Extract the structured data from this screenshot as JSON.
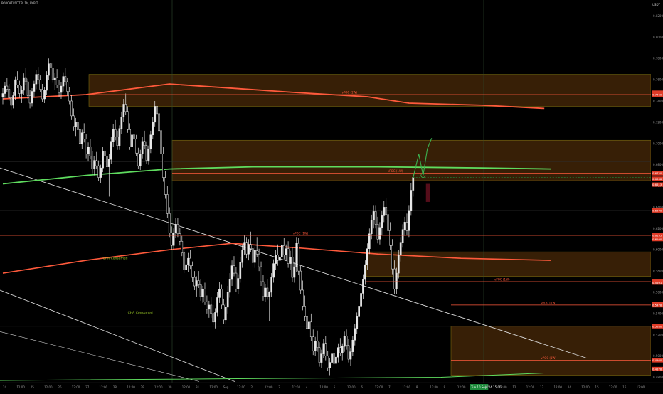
{
  "header": {
    "symbol_line": "POPCATUSDT.P, 1h, BYBIT",
    "currency": "USDT"
  },
  "colors": {
    "background": "#000000",
    "candle": "#e8e8e8",
    "zone_fill": "#4a2a08",
    "zone_border": "#7a6a10",
    "poc_line": "#ff5a3c",
    "vwap_green": "#5fdc5f",
    "trendline": "#d8d8d8",
    "price_badge": "#1e8c3c",
    "label_red": "#e03c28",
    "annotation_green": "#a0d028",
    "forecast_green": "#3cb450"
  },
  "chart_data": {
    "type": "candlestick",
    "title": "POPCATUSDT.P, 1h, BYBIT",
    "y_axis": {
      "ticks": [
        "0.8200",
        "0.8000",
        "0.7800",
        "0.7600",
        "0.7400",
        "0.7200",
        "0.7000",
        "0.6800",
        "0.6600",
        "0.6400",
        "0.6200",
        "0.6000",
        "0.5800",
        "0.5600",
        "0.5400",
        "0.5200",
        "0.5000",
        "0.4800"
      ],
      "ylim": [
        0.475,
        0.835
      ]
    },
    "x_axis": {
      "ticks": [
        "24",
        "12:00",
        "25",
        "12:00",
        "26",
        "12:00",
        "27",
        "12:00",
        "28",
        "12:00",
        "29",
        "12:00",
        "30",
        "12:00",
        "31",
        "12:00",
        "Sep",
        "12:00",
        "2",
        "12:00",
        "3",
        "12:00",
        "4",
        "12:00",
        "5",
        "12:00",
        "6",
        "12:00",
        "7",
        "12:00",
        "8",
        "12:00",
        "9",
        "12:00",
        "Tue 10 Sep '24  15:00",
        "11",
        "12:00",
        "12",
        "12:00",
        "13",
        "12:00",
        "14",
        "12:00",
        "15",
        "12:00",
        "16",
        "12:00"
      ]
    },
    "last_price": "0.6679",
    "price_labels": [
      "0.7478",
      "0.7460",
      "0.6720",
      "0.6668",
      "0.6613",
      "0.6370",
      "0.6135",
      "0.6100",
      "0.5700",
      "0.5691",
      "0.5489",
      "0.5478",
      "0.5280",
      "0.4960",
      "0.4878"
    ],
    "zones": [
      {
        "top": 0.765,
        "bottom": 0.735
      },
      {
        "top": 0.703,
        "bottom": 0.665
      },
      {
        "top": 0.598,
        "bottom": 0.575
      },
      {
        "top": 0.528,
        "bottom": 0.482
      }
    ],
    "levels": [
      {
        "label": "vPOC (1W)",
        "value": 0.746
      },
      {
        "label": "vPOC (1W)",
        "value": 0.672
      },
      {
        "label": "vPOC (1W)",
        "value": 0.6135
      },
      {
        "label": "vPOC (1W)",
        "value": 0.57
      },
      {
        "label": "vPOC (1W)",
        "value": 0.548
      },
      {
        "label": "vPOC (1W)",
        "value": 0.496
      }
    ],
    "annotations": [
      {
        "text": "CHA Consumed",
        "x_index": 48,
        "value": 0.591
      },
      {
        "text": "CHA Consumed",
        "x_index": 60,
        "value": 0.54
      }
    ],
    "vwap_curves": [
      {
        "name": "",
        "values_at": [
          [
            0,
            0.742
          ],
          [
            40,
            0.746
          ],
          [
            80,
            0.756
          ],
          [
            140,
            0.748
          ],
          [
            175,
            0.744
          ],
          [
            195,
            0.738
          ],
          [
            230,
            0.736
          ],
          [
            260,
            0.733
          ]
        ]
      },
      {
        "name": "",
        "values_at": [
          [
            0,
            0.578
          ],
          [
            40,
            0.59
          ],
          [
            80,
            0.6
          ],
          [
            110,
            0.606
          ],
          [
            140,
            0.602
          ],
          [
            180,
            0.596
          ],
          [
            220,
            0.592
          ],
          [
            263,
            0.59
          ]
        ]
      },
      {
        "name": "",
        "values_at": [
          [
            0,
            0.662
          ],
          [
            40,
            0.67
          ],
          [
            80,
            0.676
          ],
          [
            120,
            0.678
          ],
          [
            180,
            0.678
          ],
          [
            230,
            0.677
          ],
          [
            263,
            0.676
          ]
        ]
      }
    ],
    "candles": [
      [
        0.744,
        0.752,
        0.737,
        0.747
      ],
      [
        0.747,
        0.758,
        0.743,
        0.754
      ],
      [
        0.754,
        0.762,
        0.748,
        0.751
      ],
      [
        0.751,
        0.756,
        0.74,
        0.743
      ],
      [
        0.743,
        0.749,
        0.732,
        0.736
      ],
      [
        0.736,
        0.748,
        0.733,
        0.745
      ],
      [
        0.745,
        0.763,
        0.741,
        0.76
      ],
      [
        0.76,
        0.768,
        0.752,
        0.755
      ],
      [
        0.755,
        0.759,
        0.743,
        0.747
      ],
      [
        0.747,
        0.754,
        0.738,
        0.75
      ],
      [
        0.75,
        0.766,
        0.746,
        0.762
      ],
      [
        0.762,
        0.771,
        0.755,
        0.758
      ],
      [
        0.758,
        0.761,
        0.742,
        0.745
      ],
      [
        0.745,
        0.75,
        0.733,
        0.738
      ],
      [
        0.738,
        0.752,
        0.735,
        0.749
      ],
      [
        0.749,
        0.759,
        0.744,
        0.756
      ],
      [
        0.756,
        0.769,
        0.751,
        0.765
      ],
      [
        0.765,
        0.772,
        0.756,
        0.76
      ],
      [
        0.76,
        0.764,
        0.748,
        0.751
      ],
      [
        0.751,
        0.756,
        0.739,
        0.742
      ],
      [
        0.742,
        0.753,
        0.738,
        0.75
      ],
      [
        0.75,
        0.768,
        0.746,
        0.764
      ],
      [
        0.764,
        0.78,
        0.76,
        0.775
      ],
      [
        0.775,
        0.788,
        0.768,
        0.771
      ],
      [
        0.771,
        0.776,
        0.757,
        0.76
      ],
      [
        0.76,
        0.766,
        0.75,
        0.762
      ],
      [
        0.762,
        0.77,
        0.752,
        0.755
      ],
      [
        0.755,
        0.76,
        0.744,
        0.748
      ],
      [
        0.748,
        0.758,
        0.742,
        0.754
      ],
      [
        0.754,
        0.767,
        0.749,
        0.763
      ],
      [
        0.763,
        0.771,
        0.755,
        0.758
      ],
      [
        0.758,
        0.762,
        0.745,
        0.749
      ],
      [
        0.749,
        0.753,
        0.737,
        0.74
      ],
      [
        0.74,
        0.746,
        0.722,
        0.726
      ],
      [
        0.726,
        0.733,
        0.712,
        0.716
      ],
      [
        0.716,
        0.724,
        0.707,
        0.72
      ],
      [
        0.72,
        0.728,
        0.71,
        0.713
      ],
      [
        0.713,
        0.718,
        0.697,
        0.7
      ],
      [
        0.7,
        0.713,
        0.695,
        0.71
      ],
      [
        0.71,
        0.719,
        0.701,
        0.704
      ],
      [
        0.704,
        0.709,
        0.686,
        0.69
      ],
      [
        0.69,
        0.701,
        0.683,
        0.697
      ],
      [
        0.697,
        0.704,
        0.685,
        0.688
      ],
      [
        0.688,
        0.693,
        0.672,
        0.676
      ],
      [
        0.676,
        0.688,
        0.67,
        0.684
      ],
      [
        0.684,
        0.692,
        0.676,
        0.679
      ],
      [
        0.679,
        0.684,
        0.665,
        0.668
      ],
      [
        0.668,
        0.68,
        0.663,
        0.677
      ],
      [
        0.677,
        0.697,
        0.673,
        0.693
      ],
      [
        0.693,
        0.704,
        0.685,
        0.688
      ],
      [
        0.688,
        0.693,
        0.674,
        0.678
      ],
      [
        0.678,
        0.69,
        0.65,
        0.685
      ],
      [
        0.685,
        0.706,
        0.681,
        0.702
      ],
      [
        0.702,
        0.718,
        0.697,
        0.713
      ],
      [
        0.713,
        0.722,
        0.703,
        0.706
      ],
      [
        0.706,
        0.712,
        0.694,
        0.698
      ],
      [
        0.698,
        0.717,
        0.694,
        0.714
      ],
      [
        0.714,
        0.73,
        0.709,
        0.725
      ],
      [
        0.725,
        0.742,
        0.72,
        0.737
      ],
      [
        0.737,
        0.747,
        0.727,
        0.73
      ],
      [
        0.73,
        0.735,
        0.71,
        0.713
      ],
      [
        0.713,
        0.719,
        0.694,
        0.697
      ],
      [
        0.697,
        0.712,
        0.692,
        0.708
      ],
      [
        0.708,
        0.72,
        0.701,
        0.704
      ],
      [
        0.704,
        0.708,
        0.688,
        0.691
      ],
      [
        0.691,
        0.696,
        0.676,
        0.679
      ],
      [
        0.679,
        0.694,
        0.675,
        0.69
      ],
      [
        0.69,
        0.706,
        0.686,
        0.702
      ],
      [
        0.702,
        0.712,
        0.695,
        0.698
      ],
      [
        0.698,
        0.702,
        0.681,
        0.684
      ],
      [
        0.684,
        0.698,
        0.68,
        0.695
      ],
      [
        0.695,
        0.712,
        0.691,
        0.708
      ],
      [
        0.708,
        0.725,
        0.704,
        0.72
      ],
      [
        0.72,
        0.74,
        0.716,
        0.735
      ],
      [
        0.735,
        0.745,
        0.724,
        0.728
      ],
      [
        0.728,
        0.734,
        0.708,
        0.712
      ],
      [
        0.712,
        0.718,
        0.686,
        0.69
      ],
      [
        0.69,
        0.697,
        0.664,
        0.668
      ],
      [
        0.668,
        0.674,
        0.648,
        0.652
      ],
      [
        0.652,
        0.66,
        0.63,
        0.634
      ],
      [
        0.634,
        0.64,
        0.612,
        0.616
      ],
      [
        0.616,
        0.622,
        0.6,
        0.604
      ],
      [
        0.604,
        0.62,
        0.6,
        0.616
      ],
      [
        0.616,
        0.63,
        0.611,
        0.624
      ],
      [
        0.624,
        0.63,
        0.612,
        0.615
      ],
      [
        0.615,
        0.621,
        0.604,
        0.608
      ],
      [
        0.608,
        0.613,
        0.594,
        0.597
      ],
      [
        0.597,
        0.602,
        0.578,
        0.581
      ],
      [
        0.581,
        0.59,
        0.57,
        0.586
      ],
      [
        0.586,
        0.597,
        0.579,
        0.592
      ],
      [
        0.592,
        0.6,
        0.582,
        0.585
      ],
      [
        0.585,
        0.589,
        0.57,
        0.574
      ],
      [
        0.574,
        0.58,
        0.562,
        0.566
      ],
      [
        0.566,
        0.575,
        0.556,
        0.571
      ],
      [
        0.571,
        0.58,
        0.564,
        0.567
      ],
      [
        0.567,
        0.572,
        0.552,
        0.556
      ],
      [
        0.556,
        0.566,
        0.55,
        0.563
      ],
      [
        0.563,
        0.569,
        0.548,
        0.551
      ],
      [
        0.551,
        0.557,
        0.54,
        0.544
      ],
      [
        0.544,
        0.552,
        0.536,
        0.548
      ],
      [
        0.548,
        0.556,
        0.536,
        0.54
      ],
      [
        0.54,
        0.548,
        0.529,
        0.532
      ],
      [
        0.532,
        0.545,
        0.526,
        0.541
      ],
      [
        0.541,
        0.56,
        0.537,
        0.555
      ],
      [
        0.555,
        0.57,
        0.55,
        0.563
      ],
      [
        0.563,
        0.567,
        0.544,
        0.548
      ],
      [
        0.548,
        0.554,
        0.53,
        0.534
      ],
      [
        0.534,
        0.55,
        0.53,
        0.546
      ],
      [
        0.546,
        0.566,
        0.54,
        0.56
      ],
      [
        0.56,
        0.578,
        0.555,
        0.572
      ],
      [
        0.572,
        0.59,
        0.566,
        0.585
      ],
      [
        0.585,
        0.594,
        0.575,
        0.578
      ],
      [
        0.578,
        0.584,
        0.56,
        0.563
      ],
      [
        0.563,
        0.577,
        0.558,
        0.573
      ],
      [
        0.573,
        0.593,
        0.569,
        0.588
      ],
      [
        0.588,
        0.605,
        0.583,
        0.6
      ],
      [
        0.6,
        0.614,
        0.595,
        0.607
      ],
      [
        0.607,
        0.612,
        0.592,
        0.596
      ],
      [
        0.596,
        0.61,
        0.59,
        0.605
      ],
      [
        0.605,
        0.617,
        0.598,
        0.601
      ],
      [
        0.601,
        0.606,
        0.584,
        0.588
      ],
      [
        0.588,
        0.603,
        0.583,
        0.599
      ],
      [
        0.599,
        0.612,
        0.593,
        0.596
      ],
      [
        0.596,
        0.601,
        0.58,
        0.584
      ],
      [
        0.584,
        0.589,
        0.566,
        0.57
      ],
      [
        0.57,
        0.576,
        0.552,
        0.556
      ],
      [
        0.556,
        0.568,
        0.551,
        0.564
      ],
      [
        0.564,
        0.572,
        0.553,
        0.556
      ],
      [
        0.556,
        0.561,
        0.533,
        0.56
      ],
      [
        0.56,
        0.578,
        0.556,
        0.574
      ],
      [
        0.574,
        0.591,
        0.569,
        0.587
      ],
      [
        0.587,
        0.6,
        0.581,
        0.595
      ],
      [
        0.595,
        0.605,
        0.585,
        0.59
      ],
      [
        0.59,
        0.597,
        0.578,
        0.593
      ],
      [
        0.593,
        0.609,
        0.588,
        0.604
      ],
      [
        0.604,
        0.611,
        0.591,
        0.595
      ],
      [
        0.595,
        0.605,
        0.59,
        0.601
      ],
      [
        0.601,
        0.608,
        0.583,
        0.587
      ],
      [
        0.587,
        0.599,
        0.581,
        0.593
      ],
      [
        0.593,
        0.602,
        0.57,
        0.574
      ],
      [
        0.574,
        0.588,
        0.569,
        0.584
      ],
      [
        0.584,
        0.612,
        0.579,
        0.606
      ],
      [
        0.606,
        0.611,
        0.576,
        0.58
      ],
      [
        0.58,
        0.585,
        0.558,
        0.562
      ],
      [
        0.562,
        0.571,
        0.543,
        0.547
      ],
      [
        0.547,
        0.557,
        0.533,
        0.537
      ],
      [
        0.537,
        0.548,
        0.522,
        0.526
      ],
      [
        0.526,
        0.538,
        0.511,
        0.532
      ],
      [
        0.532,
        0.54,
        0.514,
        0.518
      ],
      [
        0.518,
        0.525,
        0.501,
        0.505
      ],
      [
        0.505,
        0.518,
        0.5,
        0.514
      ],
      [
        0.514,
        0.524,
        0.504,
        0.508
      ],
      [
        0.508,
        0.513,
        0.49,
        0.494
      ],
      [
        0.494,
        0.506,
        0.489,
        0.502
      ],
      [
        0.502,
        0.516,
        0.498,
        0.512
      ],
      [
        0.512,
        0.519,
        0.496,
        0.5
      ],
      [
        0.5,
        0.505,
        0.486,
        0.489
      ],
      [
        0.489,
        0.498,
        0.482,
        0.494
      ],
      [
        0.494,
        0.506,
        0.489,
        0.502
      ],
      [
        0.502,
        0.509,
        0.49,
        0.493
      ],
      [
        0.493,
        0.503,
        0.487,
        0.499
      ],
      [
        0.499,
        0.512,
        0.494,
        0.508
      ],
      [
        0.508,
        0.517,
        0.5,
        0.503
      ],
      [
        0.503,
        0.512,
        0.496,
        0.509
      ],
      [
        0.509,
        0.523,
        0.504,
        0.519
      ],
      [
        0.519,
        0.525,
        0.506,
        0.51
      ],
      [
        0.51,
        0.516,
        0.494,
        0.497
      ],
      [
        0.497,
        0.507,
        0.491,
        0.504
      ],
      [
        0.504,
        0.519,
        0.5,
        0.515
      ],
      [
        0.515,
        0.53,
        0.51,
        0.526
      ],
      [
        0.526,
        0.541,
        0.521,
        0.537
      ],
      [
        0.537,
        0.552,
        0.531,
        0.547
      ],
      [
        0.547,
        0.564,
        0.542,
        0.559
      ],
      [
        0.559,
        0.577,
        0.554,
        0.572
      ],
      [
        0.572,
        0.59,
        0.567,
        0.586
      ],
      [
        0.586,
        0.606,
        0.581,
        0.601
      ],
      [
        0.601,
        0.62,
        0.596,
        0.615
      ],
      [
        0.615,
        0.633,
        0.61,
        0.628
      ],
      [
        0.628,
        0.642,
        0.62,
        0.636
      ],
      [
        0.636,
        0.642,
        0.62,
        0.624
      ],
      [
        0.624,
        0.631,
        0.606,
        0.61
      ],
      [
        0.61,
        0.626,
        0.605,
        0.621
      ],
      [
        0.621,
        0.637,
        0.614,
        0.632
      ],
      [
        0.632,
        0.646,
        0.626,
        0.64
      ],
      [
        0.64,
        0.649,
        0.628,
        0.633
      ],
      [
        0.633,
        0.64,
        0.614,
        0.618
      ],
      [
        0.618,
        0.626,
        0.6,
        0.604
      ],
      [
        0.604,
        0.61,
        0.577,
        0.582
      ],
      [
        0.582,
        0.59,
        0.558,
        0.563
      ],
      [
        0.563,
        0.583,
        0.558,
        0.578
      ],
      [
        0.578,
        0.6,
        0.573,
        0.595
      ],
      [
        0.595,
        0.612,
        0.589,
        0.607
      ],
      [
        0.607,
        0.624,
        0.602,
        0.619
      ],
      [
        0.619,
        0.631,
        0.613,
        0.626
      ],
      [
        0.626,
        0.634,
        0.614,
        0.618
      ],
      [
        0.618,
        0.642,
        0.612,
        0.637
      ],
      [
        0.637,
        0.663,
        0.632,
        0.656
      ],
      [
        0.656,
        0.672,
        0.65,
        0.668
      ]
    ]
  }
}
